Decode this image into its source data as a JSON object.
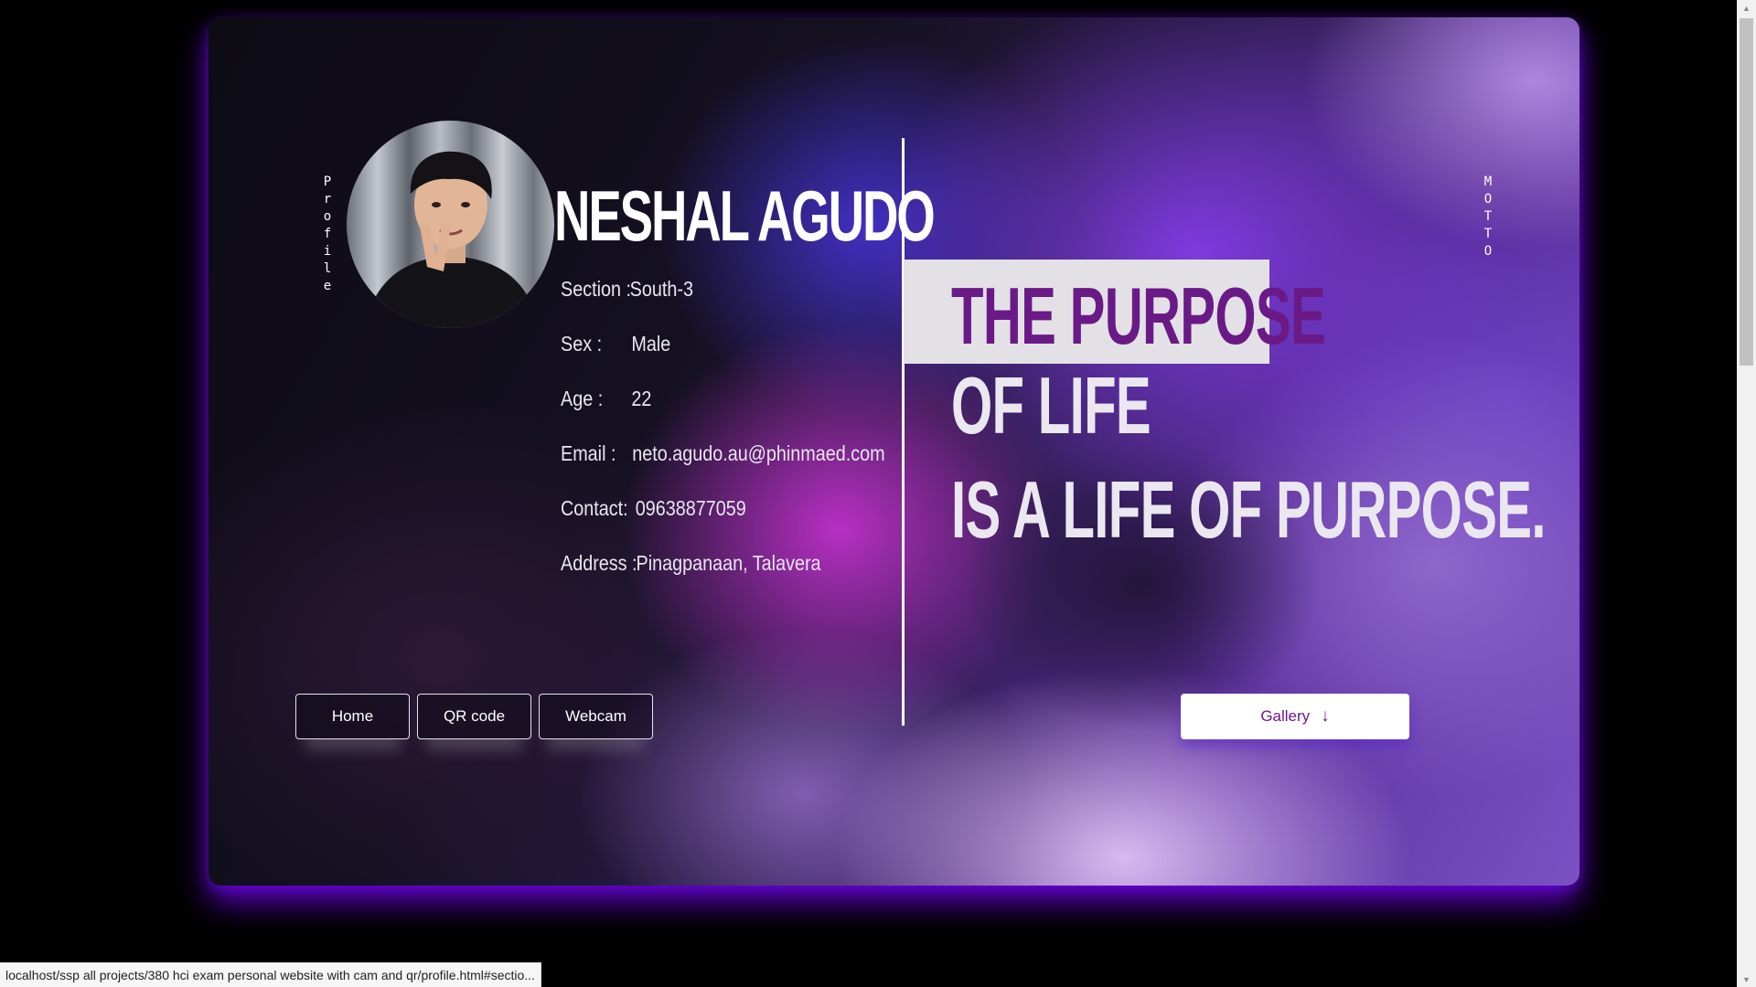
{
  "profile": {
    "side_label": "Profile",
    "name": "NESHAL AGUDO",
    "info": [
      {
        "label": "Section :",
        "value": "South-3"
      },
      {
        "label": "Sex :",
        "value": "Male"
      },
      {
        "label": "Age :",
        "value": "22"
      },
      {
        "label": "Email :",
        "value": "neto.agudo.au@phinmaed.com"
      },
      {
        "label": "Contact:",
        "value": "09638877059"
      },
      {
        "label": "Address :",
        "value": "Pinagpanaan, Talavera"
      }
    ]
  },
  "motto": {
    "side_label": "MOTTO",
    "line1": "THE PURPOSE",
    "line2": "OF LIFE",
    "line3": "IS A LIFE OF PURPOSE."
  },
  "nav": {
    "home": "Home",
    "qr": "QR code",
    "webcam": "Webcam"
  },
  "gallery": {
    "label": "Gallery",
    "arrow": "↓"
  },
  "status_bar": {
    "url": "localhost/ssp all projects/380 hci exam personal website with cam and qr/profile.html#sectio..."
  },
  "colors": {
    "accent_purple": "#6a1a86",
    "glow": "#7b00ff"
  }
}
